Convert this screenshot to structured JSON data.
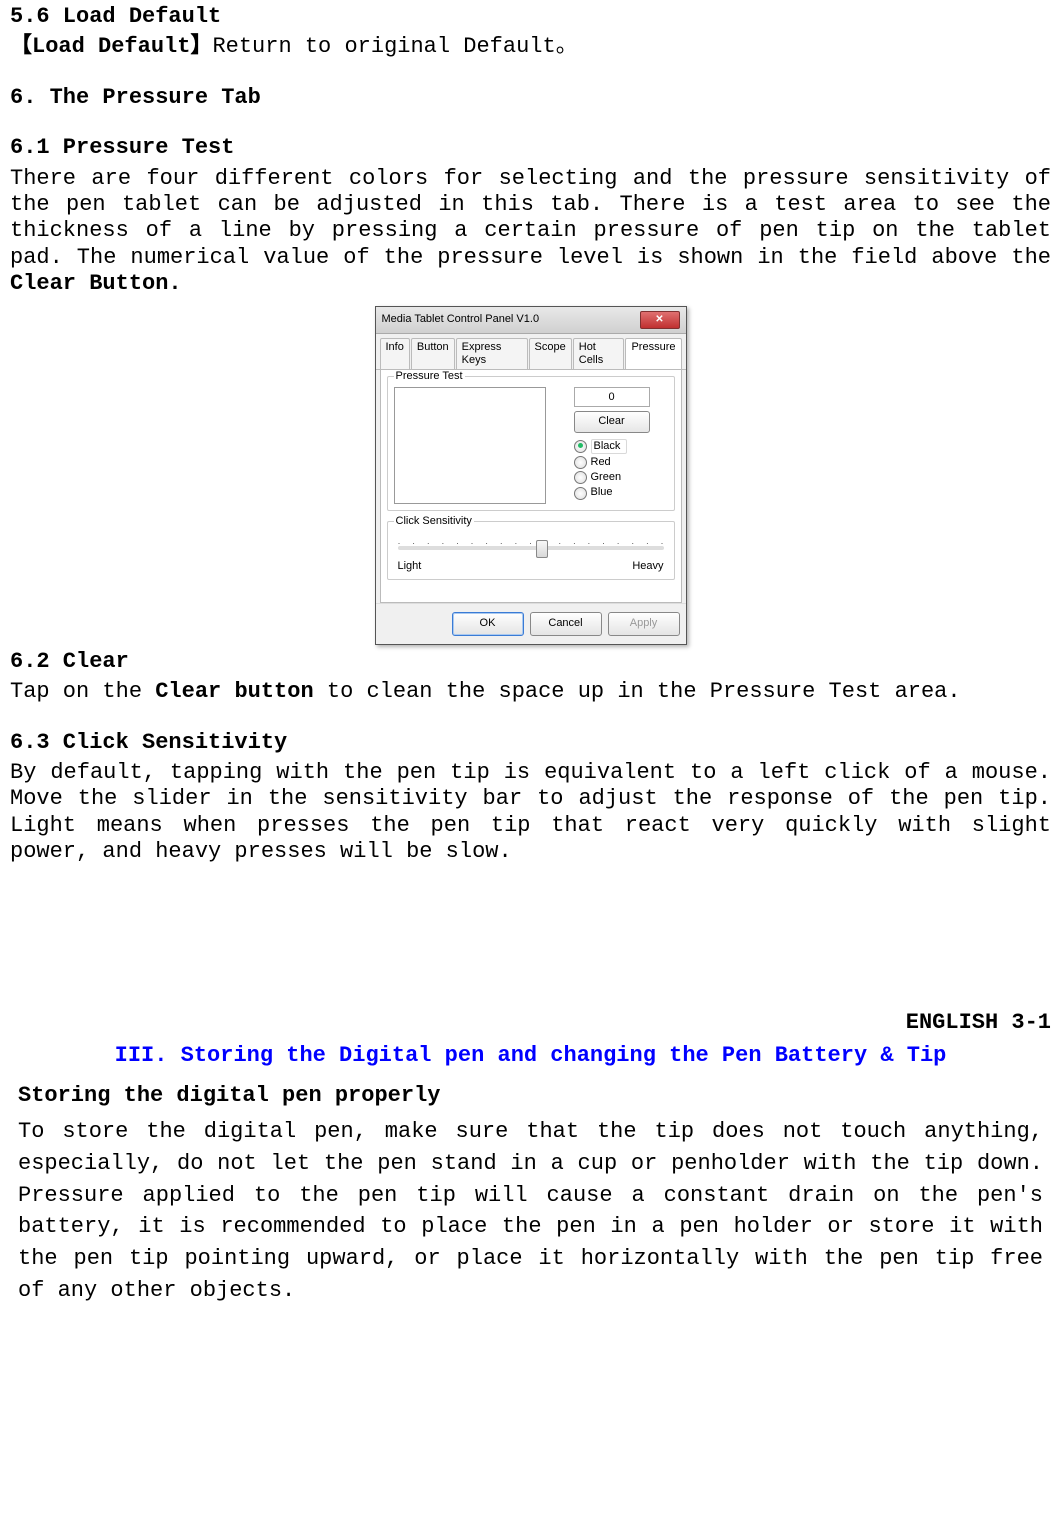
{
  "s56": {
    "heading": "5.6 Load Default",
    "bracketed": "【Load Default】",
    "rest": "Return to original Default。"
  },
  "s6": {
    "heading": "6. The Pressure Tab"
  },
  "s61": {
    "heading": "6.1 Pressure Test",
    "body_a": "There are four different colors for selecting and the pressure sensitivity of the pen tablet can be adjusted in this tab. There is a test area to see the thickness of a line by pressing a certain pressure of pen tip on the tablet pad. The numerical value of the pressure level is shown in the field above the ",
    "body_b": "Clear Button."
  },
  "dialog": {
    "title": "Media Tablet Control Panel V1.0",
    "tabs": [
      "Info",
      "Button",
      "Express Keys",
      "Scope",
      "Hot Cells",
      "Pressure"
    ],
    "active_tab": 5,
    "group_pt": "Pressure Test",
    "pressure_value": "0",
    "clear_label": "Clear",
    "colors": [
      "Black",
      "Red",
      "Green",
      "Blue"
    ],
    "selected_color": 0,
    "group_cs": "Click Sensitivity",
    "slider_left": "Light",
    "slider_right": "Heavy",
    "ok": "OK",
    "cancel": "Cancel",
    "apply": "Apply"
  },
  "s62": {
    "heading": "6.2 Clear",
    "body_a": "Tap on the ",
    "body_b": "Clear button",
    "body_c": " to clean the space up in the Pressure Test area."
  },
  "s63": {
    "heading": "6.3 Click Sensitivity",
    "body": "By default, tapping with the pen tip is equivalent to a left click of a mouse. Move the slider in the sensitivity bar to adjust the response of the pen tip. Light means when presses the pen tip that react very quickly with slight power, and heavy presses will be slow."
  },
  "page_label": "ENGLISH 3-1",
  "part3": {
    "title": "III. Storing the Digital pen and changing the Pen Battery & Tip",
    "sub": "Storing the digital pen properly",
    "body": "To store the digital pen, make sure that the tip does not touch anything, especially, do not let the pen stand in a cup or penholder with the tip down. Pressure applied to the pen tip will cause a constant drain on the pen's battery, it is recommended to place the pen in a pen holder or store it with the pen tip pointing upward, or place it horizontally with the pen tip free of any other objects."
  }
}
